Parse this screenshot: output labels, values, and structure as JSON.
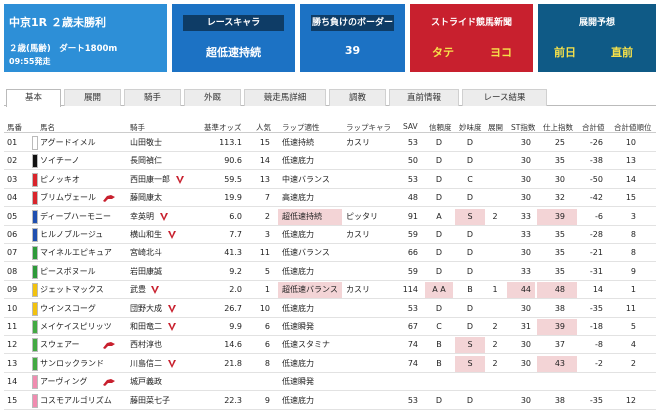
{
  "race": {
    "title": "中京1R ２歳未勝利",
    "line2": "２歳(馬齢)　ダート1800m",
    "line3": "09:55発走"
  },
  "cards": {
    "racecara": {
      "label": "レースキャラ",
      "value": "超低速持続"
    },
    "border": {
      "label": "勝ち負けのボーダー",
      "value": "39"
    },
    "stride": {
      "label": "ストライド競馬新聞",
      "tate": "タテ",
      "yoko": "ヨコ"
    },
    "tenkai": {
      "label": "展開予想",
      "zenjitsu": "前日",
      "chokuzen": "直前"
    }
  },
  "tabs": [
    "基本",
    "展開",
    "騎手",
    "外厩",
    "競走馬詳細",
    "調教",
    "直前情報",
    "レース結果"
  ],
  "columns": [
    "馬番",
    "馬名",
    "騎手",
    "基準オッズ",
    "人気",
    "ラップ適性",
    "ラップキャラ",
    "SAV",
    "信頼度",
    "妙味度",
    "展開",
    "ST指数",
    "仕上指数",
    "合計値",
    "合計値順位"
  ],
  "colors": {
    "accent_blue": "#2d8fd7",
    "dark_blue": "#1c72c4",
    "red": "#c8202e",
    "navy": "#0f5a86",
    "highlight": "#f3d4d6"
  },
  "rows": [
    {
      "num": "01",
      "color": "#ffffff",
      "name": "アグードイメル",
      "jockey": "山田敬士",
      "odds": "113.1",
      "pop": "15",
      "lap": "低速持続",
      "char": "カスリ",
      "sav": "53",
      "trust": "D",
      "myomi": "D",
      "tenkai": "",
      "st": "30",
      "shiage": "25",
      "total": "-26",
      "rank": "10",
      "icon": ""
    },
    {
      "num": "02",
      "color": "#111111",
      "name": "ソイチーノ",
      "jockey": "長岡禎仁",
      "odds": "90.6",
      "pop": "14",
      "lap": "低速底力",
      "char": "",
      "sav": "50",
      "trust": "D",
      "myomi": "D",
      "tenkai": "",
      "st": "30",
      "shiage": "35",
      "total": "-38",
      "rank": "13",
      "icon": ""
    },
    {
      "num": "03",
      "color": "#d9242b",
      "name": "ピノッキオ",
      "jockey": "西田康一郎",
      "odds": "59.5",
      "pop": "13",
      "lap": "中速バランス",
      "char": "",
      "sav": "53",
      "trust": "D",
      "myomi": "C",
      "tenkai": "",
      "st": "30",
      "shiage": "30",
      "total": "-50",
      "rank": "14",
      "icon": "spur"
    },
    {
      "num": "04",
      "color": "#d9242b",
      "name": "ブリムヴェール",
      "jockey": "藤岡康太",
      "odds": "19.9",
      "pop": "7",
      "lap": "高速底力",
      "char": "",
      "sav": "48",
      "trust": "D",
      "myomi": "D",
      "tenkai": "",
      "st": "30",
      "shiage": "32",
      "total": "-42",
      "rank": "15",
      "icon": "horse"
    },
    {
      "num": "05",
      "color": "#1f4fb0",
      "name": "ディープハーモニー",
      "jockey": "幸英明",
      "odds": "6.0",
      "pop": "2",
      "lap": "超低速持続",
      "char": "ピッタリ",
      "sav": "91",
      "trust": "A",
      "myomi": "S",
      "tenkai": "2",
      "st": "33",
      "shiage": "39",
      "total": "-6",
      "rank": "3",
      "icon": "spur"
    },
    {
      "num": "06",
      "color": "#1f4fb0",
      "name": "ヒルノブルージュ",
      "jockey": "横山和生",
      "odds": "7.7",
      "pop": "3",
      "lap": "低速底力",
      "char": "カスリ",
      "sav": "59",
      "trust": "D",
      "myomi": "D",
      "tenkai": "",
      "st": "33",
      "shiage": "35",
      "total": "-28",
      "rank": "8",
      "icon": "spur"
    },
    {
      "num": "07",
      "color": "#2e9a3a",
      "name": "マイネルエピキュア",
      "jockey": "宮崎北斗",
      "odds": "41.3",
      "pop": "11",
      "lap": "低速バランス",
      "char": "",
      "sav": "66",
      "trust": "D",
      "myomi": "D",
      "tenkai": "",
      "st": "30",
      "shiage": "35",
      "total": "-21",
      "rank": "8",
      "icon": ""
    },
    {
      "num": "08",
      "color": "#2e9a3a",
      "name": "ピースボヌール",
      "jockey": "岩田康誠",
      "odds": "9.2",
      "pop": "5",
      "lap": "低速底力",
      "char": "",
      "sav": "59",
      "trust": "D",
      "myomi": "D",
      "tenkai": "",
      "st": "33",
      "shiage": "35",
      "total": "-31",
      "rank": "9",
      "icon": ""
    },
    {
      "num": "09",
      "color": "#f2c20e",
      "name": "ジェットマックス",
      "jockey": "武豊",
      "odds": "2.0",
      "pop": "1",
      "lap": "超低速バランス",
      "char": "カスリ",
      "sav": "114",
      "trust": "A A",
      "myomi": "B",
      "tenkai": "1",
      "st": "44",
      "shiage": "48",
      "total": "14",
      "rank": "1",
      "icon": "spur"
    },
    {
      "num": "10",
      "color": "#f2c20e",
      "name": "ウインスコーグ",
      "jockey": "団野大成",
      "odds": "26.7",
      "pop": "10",
      "lap": "低速底力",
      "char": "",
      "sav": "53",
      "trust": "D",
      "myomi": "D",
      "tenkai": "",
      "st": "30",
      "shiage": "38",
      "total": "-35",
      "rank": "11",
      "icon": "spur"
    },
    {
      "num": "11",
      "color": "#43a943",
      "name": "メイケイスピリッツ",
      "jockey": "和田竜二",
      "odds": "9.9",
      "pop": "6",
      "lap": "低速瞬発",
      "char": "",
      "sav": "67",
      "trust": "C",
      "myomi": "D",
      "tenkai": "2",
      "st": "31",
      "shiage": "39",
      "total": "-18",
      "rank": "5",
      "icon": "spur"
    },
    {
      "num": "12",
      "color": "#43a943",
      "name": "スウェアー",
      "jockey": "西村淳也",
      "odds": "14.6",
      "pop": "6",
      "lap": "低速スタミナ",
      "char": "",
      "sav": "74",
      "trust": "B",
      "myomi": "S",
      "tenkai": "2",
      "st": "30",
      "shiage": "37",
      "total": "-8",
      "rank": "4",
      "icon": "horse"
    },
    {
      "num": "13",
      "color": "#43a943",
      "name": "サンロックランド",
      "jockey": "川島信二",
      "odds": "21.8",
      "pop": "8",
      "lap": "低速底力",
      "char": "",
      "sav": "74",
      "trust": "B",
      "myomi": "S",
      "tenkai": "2",
      "st": "30",
      "shiage": "43",
      "total": "-2",
      "rank": "2",
      "icon": "spur"
    },
    {
      "num": "14",
      "color": "#f08cb0",
      "name": "アーヴィング",
      "jockey": "城戸義政",
      "odds": "",
      "pop": "",
      "lap": "低速瞬発",
      "char": "",
      "sav": "",
      "trust": "",
      "myomi": "",
      "tenkai": "",
      "st": "",
      "shiage": "",
      "total": "",
      "rank": "",
      "icon": "horse"
    },
    {
      "num": "15",
      "color": "#f08cb0",
      "name": "コスモアルゴリズム",
      "jockey": "藤田菜七子",
      "odds": "22.3",
      "pop": "9",
      "lap": "低速底力",
      "char": "",
      "sav": "53",
      "trust": "D",
      "myomi": "D",
      "tenkai": "",
      "st": "30",
      "shiage": "38",
      "total": "-35",
      "rank": "12",
      "icon": ""
    }
  ]
}
